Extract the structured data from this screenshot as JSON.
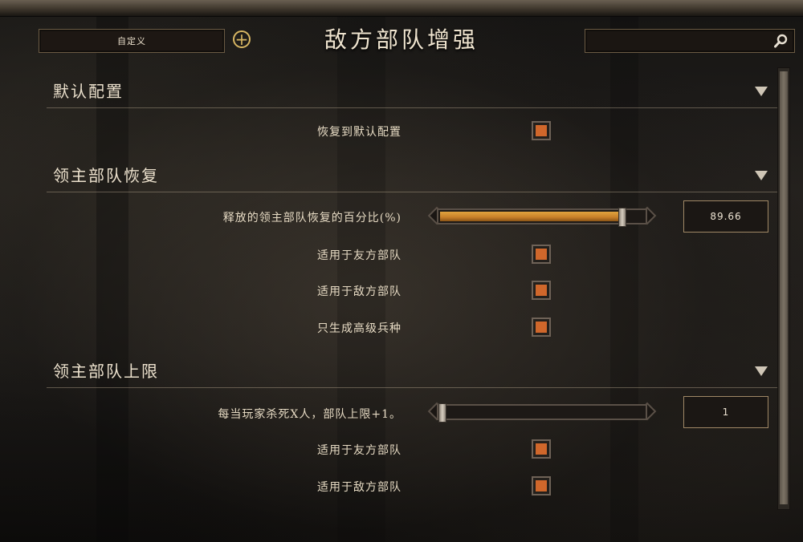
{
  "header": {
    "title": "敌方部队增强",
    "preset_label": "自定义",
    "add_icon": "plus-circle-icon",
    "search_value": "",
    "search_icon": "magnifier-icon"
  },
  "sections": [
    {
      "title": "默认配置",
      "settings": [
        {
          "label": "恢复到默认配置",
          "type": "checkbox",
          "checked": true
        }
      ]
    },
    {
      "title": "领主部队恢复",
      "settings": [
        {
          "label": "释放的领主部队恢复的百分比(%)",
          "type": "slider",
          "value": "89.66",
          "fill_fraction": 0.8966
        },
        {
          "label": "适用于友方部队",
          "type": "checkbox",
          "checked": true
        },
        {
          "label": "适用于敌方部队",
          "type": "checkbox",
          "checked": true
        },
        {
          "label": "只生成高级兵种",
          "type": "checkbox",
          "checked": true
        }
      ]
    },
    {
      "title": "领主部队上限",
      "settings": [
        {
          "label": "每当玩家杀死X人，部队上限+1。",
          "type": "slider",
          "value": "1",
          "fill_fraction": 0.0
        },
        {
          "label": "适用于友方部队",
          "type": "checkbox",
          "checked": true
        },
        {
          "label": "适用于敌方部队",
          "type": "checkbox",
          "checked": true
        }
      ]
    }
  ],
  "colors": {
    "accent_orange": "#d0672b",
    "slider_fill": "#c9822a",
    "gold_icon": "#d6b562"
  }
}
